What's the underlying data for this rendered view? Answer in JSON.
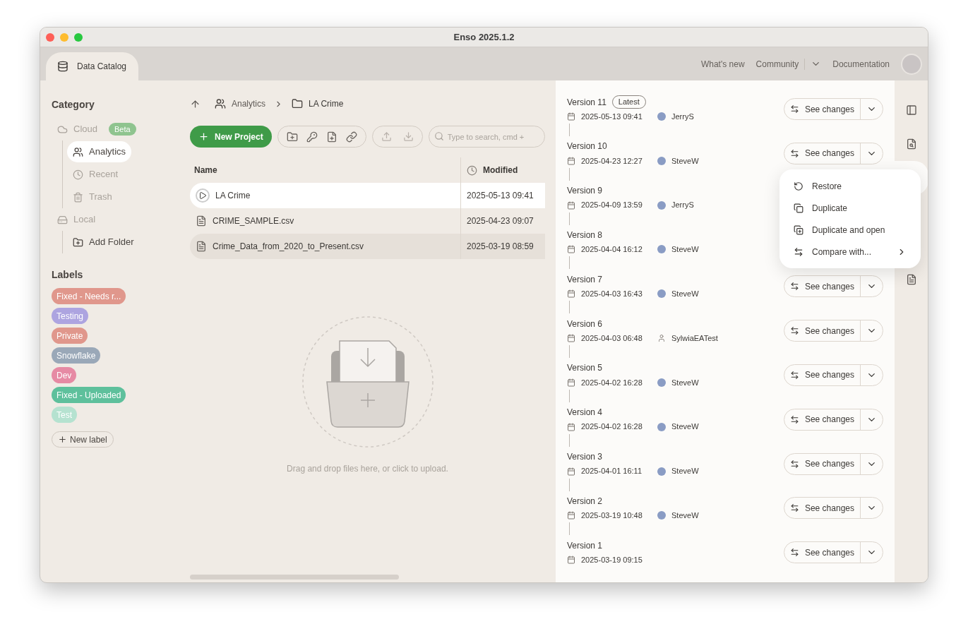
{
  "window": {
    "title": "Enso 2025.1.2"
  },
  "top_bar": {
    "tab": "Data Catalog",
    "links": [
      {
        "label": "What's new",
        "dropdown": false
      },
      {
        "label": "Community",
        "dropdown": true
      },
      {
        "label": "Documentation",
        "dropdown": false
      }
    ]
  },
  "sidebar": {
    "category_title": "Category",
    "items": [
      {
        "kind": "cloud",
        "label": "Cloud",
        "badge": "Beta",
        "disabled": true,
        "selected": false,
        "children": [
          {
            "kind": "team",
            "label": "Analytics",
            "disabled": false,
            "selected": true
          },
          {
            "kind": "recent",
            "label": "Recent",
            "disabled": true,
            "selected": false
          },
          {
            "kind": "trash",
            "label": "Trash",
            "disabled": true,
            "selected": false
          }
        ]
      },
      {
        "kind": "local",
        "label": "Local",
        "disabled": true,
        "selected": false,
        "children": [
          {
            "kind": "add-folder",
            "label": "Add Folder",
            "disabled": false,
            "selected": false
          }
        ]
      }
    ],
    "labels_title": "Labels",
    "labels": [
      {
        "label": "Fixed - Needs r...",
        "color": "#e0978c"
      },
      {
        "label": "Testing",
        "color": "#ada4e0"
      },
      {
        "label": "Private",
        "color": "#e0978c"
      },
      {
        "label": "Snowflake",
        "color": "#9aa8b8"
      },
      {
        "label": "Dev",
        "color": "#e68aa4"
      },
      {
        "label": "Fixed - Uploaded",
        "color": "#5ec09c"
      },
      {
        "label": "Test",
        "color": "#b5e2d0"
      }
    ],
    "new_label": "New label"
  },
  "breadcrumb": [
    {
      "kind": "team",
      "label": "Analytics"
    },
    {
      "kind": "folder",
      "label": "LA Crime"
    }
  ],
  "toolbar": {
    "new_project": "New Project",
    "search": {
      "placeholder": "Type to search, cmd +"
    }
  },
  "table": {
    "columns": [
      "Name",
      "Modified"
    ],
    "rows": [
      {
        "kind": "project",
        "name": "LA Crime",
        "modified": "2025-05-13 09:41",
        "selected": true,
        "hovered": false
      },
      {
        "kind": "file",
        "name": "CRIME_SAMPLE.csv",
        "modified": "2025-04-23 09:07",
        "selected": false,
        "hovered": false
      },
      {
        "kind": "file",
        "name": "Crime_Data_from_2020_to_Present.csv",
        "modified": "2025-03-19 08:59",
        "selected": false,
        "hovered": true
      }
    ]
  },
  "dropzone": {
    "text": "Drag and drop files here, or click to upload."
  },
  "versions": [
    {
      "title": "Version 11",
      "badge": "Latest",
      "date": "2025-05-13 09:41",
      "user": "JerryS",
      "silhouette": false,
      "button": "See changes"
    },
    {
      "title": "Version 10",
      "date": "2025-04-23 12:27",
      "user": "SteveW",
      "silhouette": false,
      "button": "See changes"
    },
    {
      "title": "Version 9",
      "date": "2025-04-09 13:59",
      "user": "JerryS",
      "silhouette": false
    },
    {
      "title": "Version 8",
      "date": "2025-04-04 16:12",
      "user": "SteveW",
      "silhouette": false
    },
    {
      "title": "Version 7",
      "date": "2025-04-03 16:43",
      "user": "SteveW",
      "silhouette": false,
      "button": "See changes"
    },
    {
      "title": "Version 6",
      "date": "2025-04-03 06:48",
      "user": "SylwiaEATest",
      "silhouette": true,
      "button": "See changes"
    },
    {
      "title": "Version 5",
      "date": "2025-04-02 16:28",
      "user": "SteveW",
      "silhouette": false,
      "button": "See changes"
    },
    {
      "title": "Version 4",
      "date": "2025-04-02 16:28",
      "user": "SteveW",
      "silhouette": false,
      "button": "See changes"
    },
    {
      "title": "Version 3",
      "date": "2025-04-01 16:11",
      "user": "SteveW",
      "silhouette": false,
      "button": "See changes"
    },
    {
      "title": "Version 2",
      "date": "2025-03-19 10:48",
      "user": "SteveW",
      "silhouette": false,
      "button": "See changes"
    },
    {
      "title": "Version 1",
      "date": "2025-03-19 09:15",
      "button": "See changes"
    }
  ],
  "context_menu": [
    {
      "kind": "restore",
      "label": "Restore",
      "submenu": false
    },
    {
      "kind": "duplicate",
      "label": "Duplicate",
      "submenu": false
    },
    {
      "kind": "duplicate-open",
      "label": "Duplicate and open",
      "submenu": false
    },
    {
      "kind": "compare",
      "label": "Compare with...",
      "submenu": true
    }
  ],
  "right_rail": [
    {
      "kind": "panel",
      "selected": false
    },
    {
      "kind": "inspect",
      "selected": false
    },
    {
      "kind": "versions",
      "selected": true
    },
    {
      "kind": "docs",
      "selected": false
    }
  ]
}
